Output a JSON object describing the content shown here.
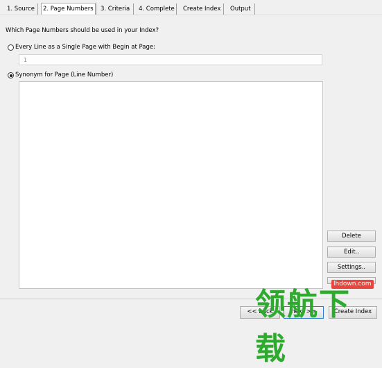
{
  "tabs": [
    {
      "label": "1. Source"
    },
    {
      "label": "2. Page Numbers"
    },
    {
      "label": "3. Criteria"
    },
    {
      "label": "4. Complete"
    },
    {
      "label": "Create Index"
    },
    {
      "label": "Output"
    }
  ],
  "active_tab": "2. Page Numbers",
  "question": "Which Page Numbers should be used in your Index?",
  "option_every_line": {
    "label": "Every Line as a Single Page with Begin at Page:",
    "selected": false
  },
  "begin_page_field": {
    "value": "1"
  },
  "option_synonym": {
    "label": "Synonym for Page (Line Number)",
    "selected": true
  },
  "side_buttons": {
    "delete": "Delete",
    "edit": "Edit..",
    "settings": "Settings.."
  },
  "bottom_buttons": {
    "back": "<< back",
    "next": "next >>",
    "create_index": "Create Index"
  },
  "watermark": {
    "text": "领航下载",
    "badge": "lhdown.com"
  },
  "colors": {
    "focus_border": "#2b7cd3",
    "watermark_green": "#2eaa2e",
    "badge_red": "#e8453c"
  }
}
